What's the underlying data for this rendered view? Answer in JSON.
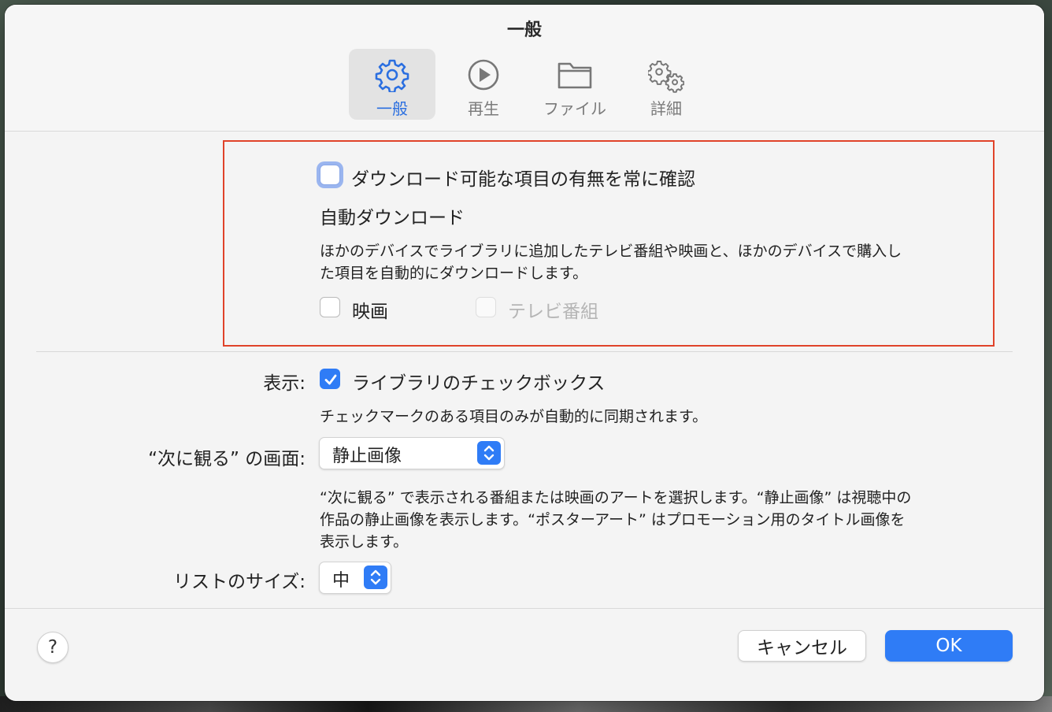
{
  "window": {
    "title": "一般"
  },
  "toolbar": {
    "tabs": [
      {
        "label": "一般",
        "icon": "gear-icon",
        "active": true
      },
      {
        "label": "再生",
        "icon": "play-circle-icon",
        "active": false
      },
      {
        "label": "ファイル",
        "icon": "folder-icon",
        "active": false
      },
      {
        "label": "詳細",
        "icon": "gears-icon",
        "active": false
      }
    ]
  },
  "download": {
    "check_available_label": "ダウンロード可能な項目の有無を常に確認",
    "check_available_checked": false,
    "auto_download_heading": "自動ダウンロード",
    "description_line1": "ほかのデバイスでライブラリに追加したテレビ番組や映画と、ほかのデバイスで購入し",
    "description_line2": "た項目を自動的にダウンロードします。",
    "movies_label": "映画",
    "movies_checked": false,
    "tv_label": "テレビ番組",
    "tv_checked": false,
    "tv_enabled": false
  },
  "display": {
    "label": "表示:",
    "library_checkbox_label": "ライブラリのチェックボックス",
    "library_checkbox_checked": true,
    "library_checkbox_description": "チェックマークのある項目のみが自動的に同期されます。"
  },
  "up_next": {
    "label": "“次に観る” の画面:",
    "selected": "静止画像",
    "description_line1": "“次に観る” で表示される番組または映画のアートを選択します。“静止画像” は視聴中の",
    "description_line2": "作品の静止画像を表示します。“ポスターアート” はプロモーション用のタイトル画像を",
    "description_line3": "表示します。"
  },
  "list_size": {
    "label": "リストのサイズ:",
    "selected": "中"
  },
  "footer": {
    "help_label": "?",
    "cancel_label": "キャンセル",
    "ok_label": "OK"
  },
  "colors": {
    "accent": "#2f7cf6",
    "highlight_border": "#e0432a"
  }
}
